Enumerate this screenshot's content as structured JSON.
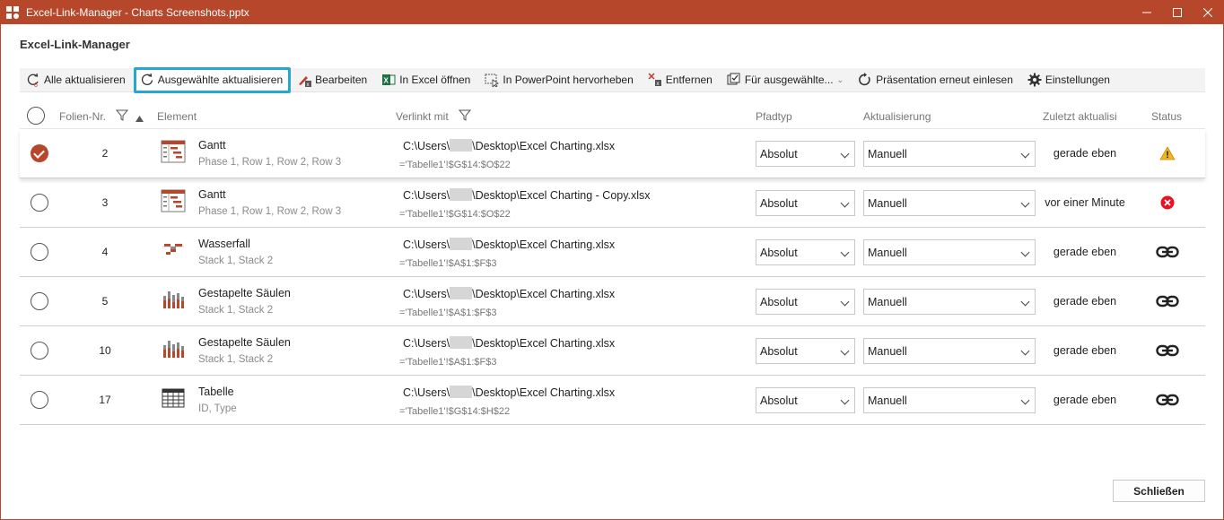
{
  "window": {
    "title": "Excel-Link-Manager - Charts Screenshots.pptx"
  },
  "heading": "Excel-Link-Manager",
  "toolbar": [
    {
      "label": "Alle aktualisieren",
      "icon": "refresh-all-icon"
    },
    {
      "label": "Ausgewählte aktualisieren",
      "icon": "refresh-icon"
    },
    {
      "label": "Bearbeiten",
      "icon": "edit-icon"
    },
    {
      "label": "In Excel öffnen",
      "icon": "excel-icon"
    },
    {
      "label": "In PowerPoint hervorheben",
      "icon": "highlight-icon"
    },
    {
      "label": "Entfernen",
      "icon": "remove-icon"
    },
    {
      "label": "Für ausgewählte...",
      "icon": "checklist-icon"
    },
    {
      "label": "Präsentation erneut einlesen",
      "icon": "reload-icon"
    },
    {
      "label": "Einstellungen",
      "icon": "gear-icon"
    }
  ],
  "columns": {
    "slide": "Folien-Nr.",
    "element": "Element",
    "linked": "Verlinkt mit",
    "path_type": "Pfadtyp",
    "update": "Aktualisierung",
    "last_updated": "Zuletzt aktualisi",
    "status": "Status"
  },
  "rows": [
    {
      "selected": true,
      "slide": "2",
      "icon": "gantt-icon",
      "name": "Gantt",
      "sub": "Phase 1, Row 1, Row 2, Row 3",
      "path_a": "C:\\Users\\",
      "path_b": "\\Desktop\\Excel Charting.xlsx",
      "range": "='Tabelle1'!$G$14:$O$22",
      "path_type": "Absolut",
      "update": "Manuell",
      "last": "gerade eben",
      "status": "warning-icon"
    },
    {
      "selected": false,
      "slide": "3",
      "icon": "gantt-icon",
      "name": "Gantt",
      "sub": "Phase 1, Row 1, Row 2, Row 3",
      "path_a": "C:\\Users\\",
      "path_b": "\\Desktop\\Excel Charting - Copy.xlsx",
      "range": "='Tabelle1'!$G$14:$O$22",
      "path_type": "Absolut",
      "update": "Manuell",
      "last": "vor einer Minute",
      "status": "error-icon"
    },
    {
      "selected": false,
      "slide": "4",
      "icon": "waterfall-icon",
      "name": "Wasserfall",
      "sub": "Stack 1, Stack 2",
      "path_a": "C:\\Users\\",
      "path_b": "\\Desktop\\Excel Charting.xlsx",
      "range": "='Tabelle1'!$A$1:$F$3",
      "path_type": "Absolut",
      "update": "Manuell",
      "last": "gerade eben",
      "status": "link-icon"
    },
    {
      "selected": false,
      "slide": "5",
      "icon": "stacked-column-icon",
      "name": "Gestapelte Säulen",
      "sub": "Stack 1, Stack 2",
      "path_a": "C:\\Users\\",
      "path_b": "\\Desktop\\Excel Charting.xlsx",
      "range": "='Tabelle1'!$A$1:$F$3",
      "path_type": "Absolut",
      "update": "Manuell",
      "last": "gerade eben",
      "status": "link-icon"
    },
    {
      "selected": false,
      "slide": "10",
      "icon": "stacked-column-icon",
      "name": "Gestapelte Säulen",
      "sub": "Stack 1, Stack 2",
      "path_a": "C:\\Users\\",
      "path_b": "\\Desktop\\Excel Charting.xlsx",
      "range": "='Tabelle1'!$A$1:$F$3",
      "path_type": "Absolut",
      "update": "Manuell",
      "last": "gerade eben",
      "status": "link-icon"
    },
    {
      "selected": false,
      "slide": "17",
      "icon": "table-icon",
      "name": "Tabelle",
      "sub": "ID, Type",
      "path_a": "C:\\Users\\",
      "path_b": "\\Desktop\\Excel Charting.xlsx",
      "range": "='Tabelle1'!$G$14:$H$22",
      "path_type": "Absolut",
      "update": "Manuell",
      "last": "gerade eben",
      "status": "link-icon"
    }
  ],
  "close_label": "Schließen",
  "colors": {
    "accent": "#b7472a",
    "focus": "#22a7d9",
    "warning": "#f0b429",
    "error": "#e81123"
  }
}
